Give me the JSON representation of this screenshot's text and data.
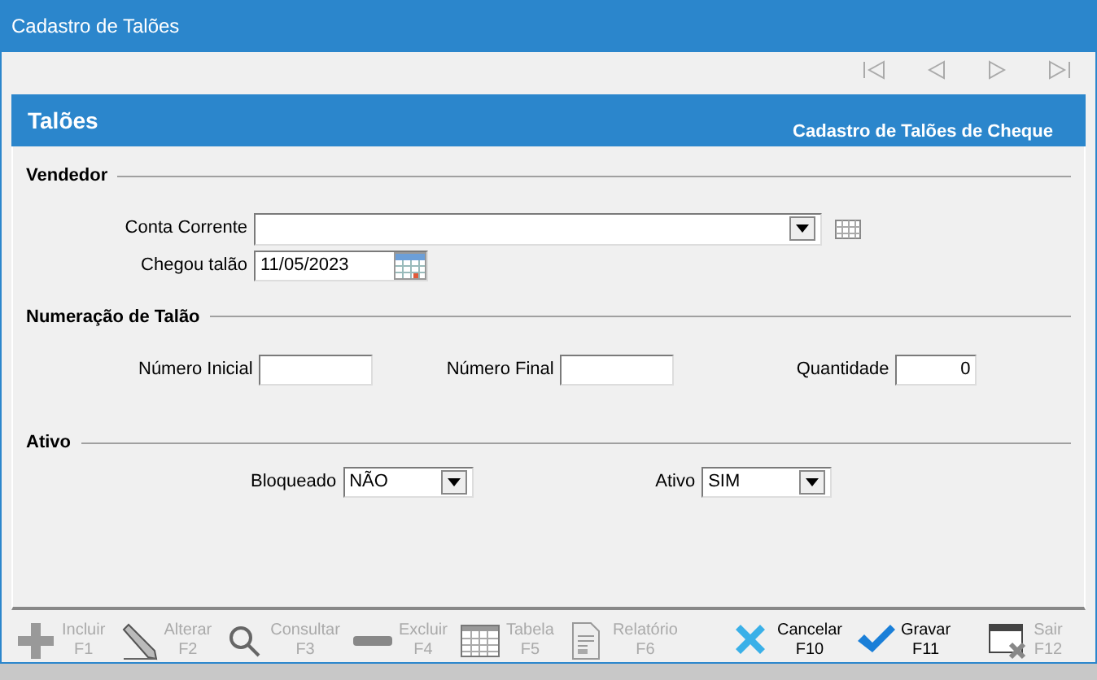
{
  "window": {
    "title": "Cadastro de Talões"
  },
  "nav_buttons": [
    {
      "kind": "first",
      "disabled": true
    },
    {
      "kind": "prev",
      "disabled": true
    },
    {
      "kind": "next",
      "disabled": true
    },
    {
      "kind": "last",
      "disabled": true
    }
  ],
  "header": {
    "title": "Talões",
    "subtitle": "Cadastro de Talões de Cheque"
  },
  "sections": [
    {
      "title": "Vendedor",
      "fields": [
        {
          "label": "Conta Corrente",
          "kind": "combo-lookup"
        },
        {
          "label": "Chegou talão",
          "kind": "date",
          "value": "11/05/2023"
        }
      ]
    },
    {
      "title": "Numeração de Talão",
      "fields": [
        {
          "label": "Número Inicial",
          "kind": "text"
        },
        {
          "label": "Número Final",
          "kind": "text"
        },
        {
          "label": "Quantidade",
          "kind": "number",
          "value": "0"
        }
      ]
    },
    {
      "title": "Ativo",
      "fields": [
        {
          "label": "Bloqueado",
          "kind": "select",
          "value": "NÃO"
        },
        {
          "label": "Ativo",
          "kind": "select",
          "value": "SIM"
        }
      ]
    }
  ],
  "toolbar": [
    {
      "kind": "add",
      "label": "Incluir",
      "key": "F1",
      "disabled": true
    },
    {
      "kind": "edit",
      "label": "Alterar",
      "key": "F2",
      "disabled": true
    },
    {
      "kind": "search",
      "label": "Consultar",
      "key": "F3",
      "disabled": true
    },
    {
      "kind": "delete",
      "label": "Excluir",
      "key": "F4",
      "disabled": true
    },
    {
      "kind": "table",
      "label": "Tabela",
      "key": "F5",
      "disabled": true
    },
    {
      "kind": "report",
      "label": "Relatório",
      "key": "F6",
      "disabled": true
    },
    {
      "kind": "cancel",
      "label": "Cancelar",
      "key": "F10",
      "disabled": false
    },
    {
      "kind": "save",
      "label": "Gravar",
      "key": "F11",
      "disabled": false
    },
    {
      "kind": "exit",
      "label": "Sair",
      "key": "F12",
      "disabled": true
    }
  ]
}
